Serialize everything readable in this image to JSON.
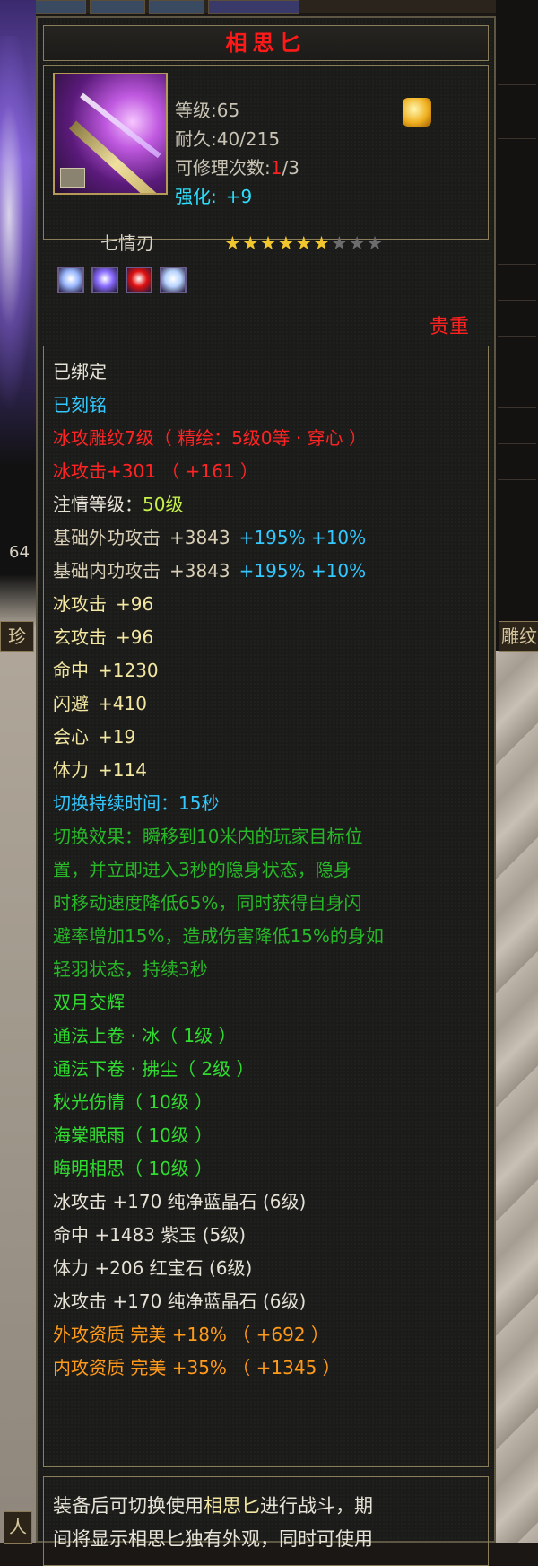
{
  "item": {
    "title": "相思匕",
    "level_label": "等级:65",
    "durability_label": "耐久:40/215",
    "repair_label": "可修理次数:",
    "repair_used": "1",
    "repair_total": "/3",
    "enhance_label": "强化:",
    "enhance_value": "+9",
    "name": "七情刃",
    "stars_filled": 6,
    "stars_total": 9,
    "rarity": "贵重",
    "gems": [
      {
        "icon": "blue-gem-icon",
        "color": "#9ab8ff"
      },
      {
        "icon": "purple-gem-icon",
        "color": "#8a6cff"
      },
      {
        "icon": "red-gem-icon",
        "color": "#e01010"
      },
      {
        "icon": "blue-gem-icon",
        "color": "#b8d4ff"
      }
    ]
  },
  "attributes": {
    "bound": "已绑定",
    "engraved": "已刻铭",
    "ice_engrave": "冰攻雕纹7级（ 精绘：5级0等 · 穿心 ）",
    "ice_attack_main": "冰攻击+301 （ +161 ）",
    "inject_label": "注情等级：",
    "inject_value": "50级",
    "base_outer": {
      "label": "基础外功攻击",
      "value": "+3843",
      "bonus": "+195% +10%"
    },
    "base_inner": {
      "label": "基础内功攻击",
      "value": "+3843",
      "bonus": "+195% +10%"
    },
    "stats": [
      {
        "label": "冰攻击",
        "value": "+96"
      },
      {
        "label": "玄攻击",
        "value": "+96"
      },
      {
        "label": "命中",
        "value": "+1230"
      },
      {
        "label": "闪避",
        "value": "+410"
      },
      {
        "label": "会心",
        "value": "+19"
      },
      {
        "label": "体力",
        "value": "+114"
      }
    ],
    "switch_duration": "切换持续时间：15秒",
    "switch_effect": [
      "切换效果：瞬移到10米内的玩家目标位",
      "置，并立即进入3秒的隐身状态，隐身",
      "时移动速度降低65%，同时获得自身闪",
      "避率增加15%，造成伤害降低15%的身如",
      "轻羽状态，持续3秒"
    ],
    "skills": [
      "双月交辉",
      "通法上卷 · 冰（ 1级 ）",
      "通法下卷 · 拂尘（ 2级 ）",
      "秋光伤情（ 10级 ）",
      "海棠眠雨（ 10级 ）",
      "晦明相思（ 10级 ）"
    ],
    "gem_stats": [
      "冰攻击 +170 纯净蓝晶石 (6级)",
      "命中 +1483 紫玉 (5级)",
      "体力 +206 红宝石 (6级)",
      "冰攻击 +170 纯净蓝晶石 (6级)"
    ],
    "aptitude": [
      "外攻资质   完美 +18% （ +692 ）",
      "内攻资质   完美 +35% （ +1345 ）"
    ]
  },
  "description": {
    "line1_a": "装备后可切换使用",
    "line1_hl": "相思匕",
    "line1_b": "进行战斗，期",
    "line2": "间将显示相思匕独有外观，同时可使用"
  },
  "background": {
    "side_tab_left": "珍",
    "side_tab_right": "雕纹",
    "left_number": "64",
    "bottom_left": "人"
  }
}
